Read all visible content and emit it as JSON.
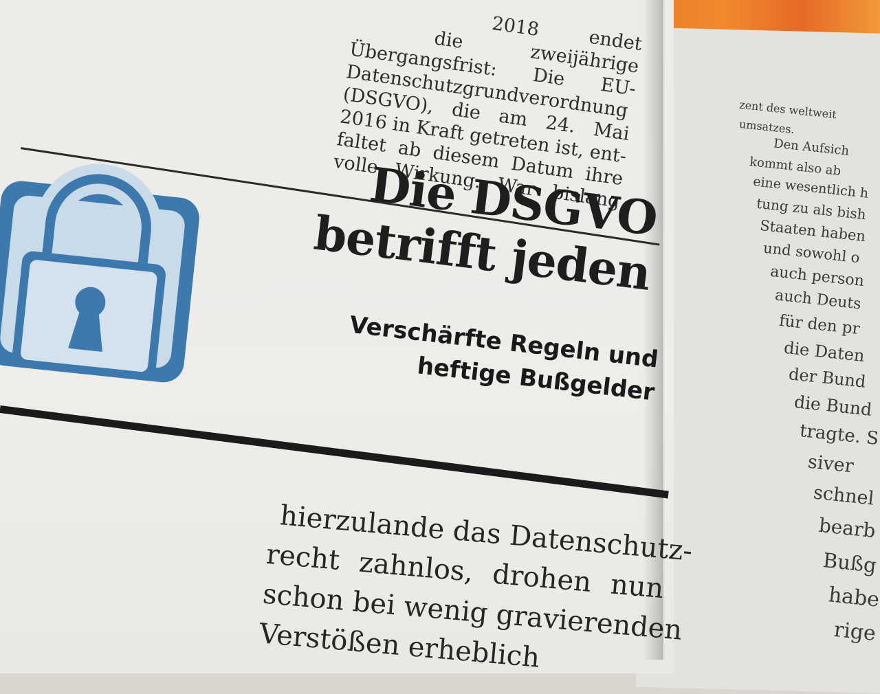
{
  "top_text_lines": [
    "2018 endet",
    "die zweijährige",
    "Übergangsfrist: Die EU-",
    "Datenschutzgrundverordnung",
    "(DSGVO), die am 24. Mai",
    "2016 in Kraft getreten ist, ent-",
    "faltet ab diesem Datum ihre",
    "volle Wirkung. War bislang"
  ],
  "headline": {
    "line1": "Die DSGVO",
    "line2": "betrifft jeden"
  },
  "subhead": {
    "line1": "Verschärfte Regeln und",
    "line2": "heftige Bußgelder"
  },
  "body_text_lines": [
    "hierzulande das Datenschutz-",
    "recht zahnlos, drohen nun",
    "schon bei wenig gravierenden",
    "Verstößen erheblich"
  ],
  "right_page_lines": [
    "zent des weltweit",
    "umsatzes.",
    "Den Aufsich",
    "kommt also ab",
    "eine wesentlich h",
    "tung zu als bish",
    "Staaten haben",
    "und sowohl o",
    "auch person",
    "auch Deuts",
    "für den pr",
    "die Daten",
    "der Bund",
    "die Bund",
    "tragte. S",
    "siver",
    "schnel",
    "bearb",
    "Bußg",
    "habe",
    "rige"
  ],
  "colors": {
    "lock_blue": "#3d79ad",
    "lock_light": "#c9dbe9",
    "ink": "#1e1e1e"
  },
  "icons": [
    "padlock-icon"
  ]
}
